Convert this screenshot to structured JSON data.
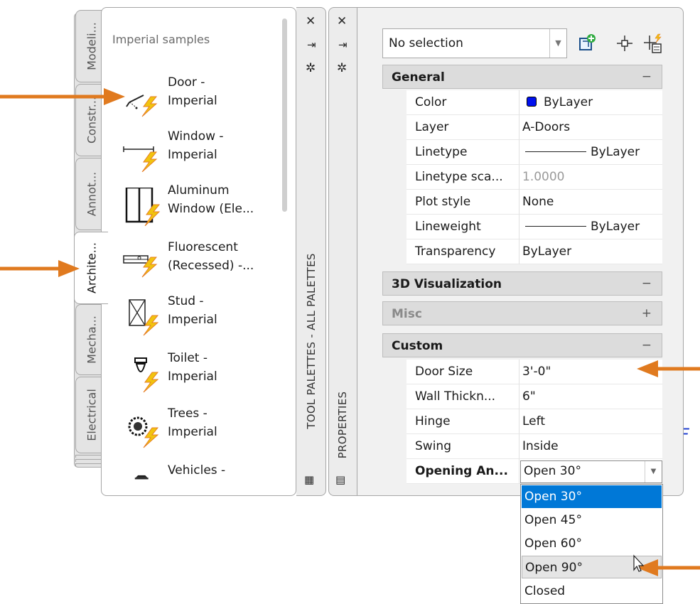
{
  "tool_palettes": {
    "heading": "Imperial samples",
    "title": "TOOL PALETTES - ALL PALETTES",
    "tabs": [
      {
        "label": "Modeli..."
      },
      {
        "label": "Constr..."
      },
      {
        "label": "Annot..."
      },
      {
        "label": "Archite..."
      },
      {
        "label": "Mecha..."
      },
      {
        "label": "Electrical"
      }
    ],
    "tools": [
      {
        "line1": "Door -",
        "line2": "Imperial",
        "icon": "door-icon"
      },
      {
        "line1": "Window -",
        "line2": "Imperial",
        "icon": "window-icon"
      },
      {
        "line1": "Aluminum",
        "line2": "Window (Ele...",
        "icon": "aluminum-window-icon"
      },
      {
        "line1": "Fluorescent",
        "line2": "(Recessed) -...",
        "icon": "fluorescent-light-icon"
      },
      {
        "line1": "Stud -",
        "line2": "Imperial",
        "icon": "stud-icon"
      },
      {
        "line1": "Toilet -",
        "line2": "Imperial",
        "icon": "toilet-icon"
      },
      {
        "line1": "Trees -",
        "line2": "Imperial",
        "icon": "tree-icon"
      },
      {
        "line1": "Vehicles -",
        "line2": "",
        "icon": "vehicle-icon"
      }
    ]
  },
  "properties": {
    "title": "PROPERTIES",
    "selection": "No selection",
    "categories": {
      "general": {
        "title": "General",
        "state": "−"
      },
      "viz": {
        "title": "3D Visualization",
        "state": "−"
      },
      "misc": {
        "title": "Misc",
        "state": "+"
      },
      "custom": {
        "title": "Custom",
        "state": "−"
      }
    },
    "general_rows": [
      {
        "name": "Color",
        "value": "ByLayer"
      },
      {
        "name": "Layer",
        "value": "A-Doors"
      },
      {
        "name": "Linetype",
        "value": "ByLayer"
      },
      {
        "name": "Linetype sca...",
        "value": "1.0000"
      },
      {
        "name": "Plot style",
        "value": "None"
      },
      {
        "name": "Lineweight",
        "value": "ByLayer"
      },
      {
        "name": "Transparency",
        "value": "ByLayer"
      }
    ],
    "custom_rows": [
      {
        "name": "Door Size",
        "value": "3'-0\""
      },
      {
        "name": "Wall Thickn...",
        "value": "6\""
      },
      {
        "name": "Hinge",
        "value": "Left"
      },
      {
        "name": "Swing",
        "value": "Inside"
      },
      {
        "name": "Opening An...",
        "value": "Open 30°"
      }
    ],
    "opening_options": [
      "Open 30°",
      "Open 45°",
      "Open 60°",
      "Open 90°",
      "Closed"
    ],
    "selected_option": "Open 30°",
    "hovered_option": "Open 90°"
  },
  "colors": {
    "arrow": "#e07a1f",
    "highlight": "#0078d7",
    "bylayer_swatch": "#0011ee"
  },
  "canvas_fragment": "F"
}
